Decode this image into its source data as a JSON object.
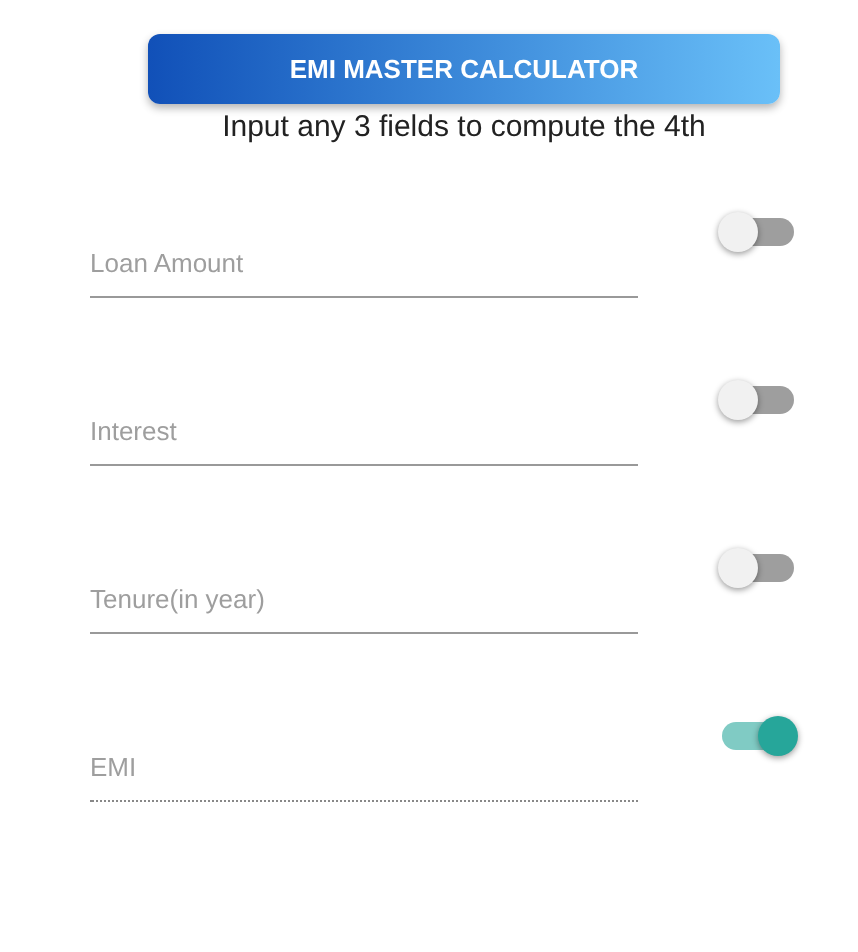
{
  "header": {
    "title": "EMI MASTER CALCULATOR"
  },
  "subtitle": "Input any 3 fields to compute the 4th",
  "fields": [
    {
      "placeholder": "Loan Amount",
      "disabled": false,
      "on": false
    },
    {
      "placeholder": "Interest",
      "disabled": false,
      "on": false
    },
    {
      "placeholder": "Tenure(in year)",
      "disabled": false,
      "on": false
    },
    {
      "placeholder": "EMI",
      "disabled": true,
      "on": true
    }
  ]
}
